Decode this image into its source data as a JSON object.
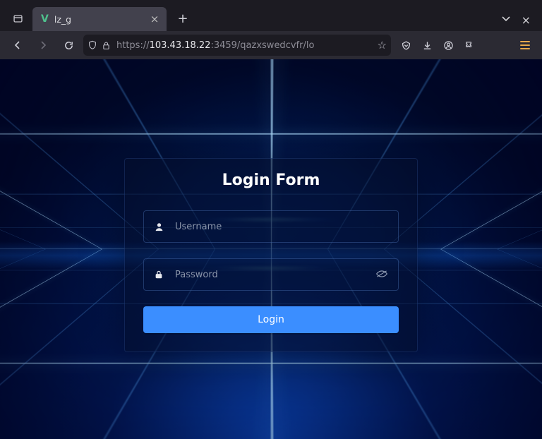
{
  "browser": {
    "tab": {
      "favicon_letter": "V",
      "title": "lz_g"
    },
    "url": {
      "scheme": "https://",
      "host": "103.43.18.22",
      "rest": ":3459/qazxswedcvfr/lo"
    }
  },
  "login": {
    "title": "Login Form",
    "username": {
      "placeholder": "Username",
      "value": ""
    },
    "password": {
      "placeholder": "Password",
      "value": ""
    },
    "submit_label": "Login"
  },
  "colors": {
    "accent": "#3b8eff"
  }
}
